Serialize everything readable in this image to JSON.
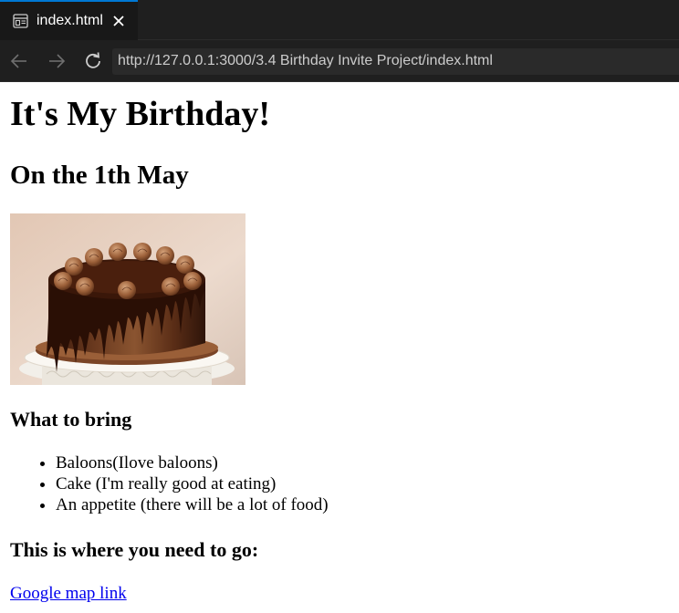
{
  "browser": {
    "tab": {
      "title": "index.html",
      "icon": "preview-icon"
    },
    "address_bar": {
      "url": "http://127.0.0.1:3000/3.4 Birthday Invite Project/index.html"
    },
    "colors": {
      "chrome_bg": "#1f1f1f",
      "active_tab_bg": "#181818",
      "accent": "#0078d4",
      "url_bg": "#2a2a2a"
    }
  },
  "page": {
    "title": "It's My Birthday!",
    "subtitle": "On the 1th May",
    "image": {
      "subject": "chocolate cake with chocolate drip and frosting rosettes on a white cake stand"
    },
    "bring": {
      "heading": "What to bring",
      "items": [
        "Baloons(Ilove baloons)",
        "Cake (I'm really good at eating)",
        "An appetite (there will be a lot of food)"
      ]
    },
    "directions": {
      "heading": "This is where you need to go:",
      "link_text": "Google map link"
    },
    "colors": {
      "link": "#0000ee",
      "text": "#000000",
      "background": "#ffffff"
    }
  }
}
